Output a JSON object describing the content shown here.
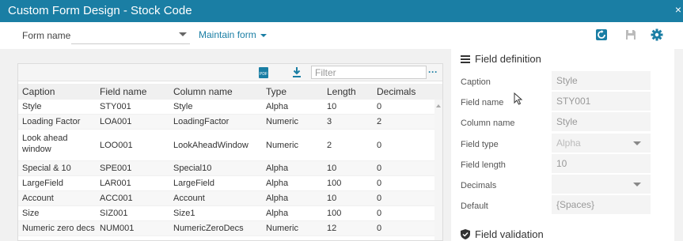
{
  "window": {
    "title": "Custom Form Design - Stock Code",
    "close": "×"
  },
  "toolbar": {
    "form_name_label": "Form name",
    "form_name_value": "",
    "maintain_label": "Maintain form",
    "icons": [
      "refresh-icon",
      "save-icon",
      "settings-icon"
    ]
  },
  "grid": {
    "filter_placeholder": "Filter",
    "more": "···",
    "columns": [
      "Caption",
      "Field name",
      "Column name",
      "Type",
      "Length",
      "Decimals"
    ],
    "rows": [
      {
        "caption": "Style",
        "field": "STY001",
        "column": "Style",
        "type": "Alpha",
        "length": "10",
        "decimals": "0"
      },
      {
        "caption": "Loading Factor",
        "field": "LOA001",
        "column": "LoadingFactor",
        "type": "Numeric",
        "length": "3",
        "decimals": "2"
      },
      {
        "caption": "Look ahead window",
        "field": "LOO001",
        "column": "LookAheadWindow",
        "type": "Numeric",
        "length": "2",
        "decimals": "0"
      },
      {
        "caption": "Special & 10",
        "field": "SPE001",
        "column": "Special10",
        "type": "Alpha",
        "length": "10",
        "decimals": "0"
      },
      {
        "caption": "LargeField",
        "field": "LAR001",
        "column": "LargeField",
        "type": "Alpha",
        "length": "100",
        "decimals": "0"
      },
      {
        "caption": "Account",
        "field": "ACC001",
        "column": "Account",
        "type": "Alpha",
        "length": "10",
        "decimals": "0"
      },
      {
        "caption": "Size",
        "field": "SIZ001",
        "column": "Size1",
        "type": "Alpha",
        "length": "100",
        "decimals": "0"
      },
      {
        "caption": "Numeric zero decs",
        "field": "NUM001",
        "column": "NumericZeroDecs",
        "type": "Numeric",
        "length": "12",
        "decimals": "0"
      }
    ]
  },
  "field_definition": {
    "title": "Field definition",
    "fields": [
      {
        "label": "Caption",
        "value": "Style"
      },
      {
        "label": "Field name",
        "value": "STY001"
      },
      {
        "label": "Column name",
        "value": "Style"
      },
      {
        "label": "Field type",
        "value": "Alpha"
      },
      {
        "label": "Field length",
        "value": "10"
      },
      {
        "label": "Decimals",
        "value": ""
      },
      {
        "label": "Default",
        "value": "{Spaces}"
      }
    ]
  },
  "field_validation": {
    "title": "Field validation"
  },
  "colors": {
    "accent": "#1a7ea4",
    "pdf": "#1a7ea4"
  }
}
